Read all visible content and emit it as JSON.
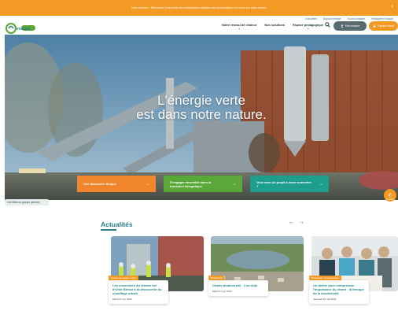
{
  "topbar": {
    "message": "Infos réseaux : Retrouvez l'ensemble des informations relatives aux perturbations en cours sur votre réseau",
    "close": "×"
  },
  "util_links": [
    "Actualités",
    "Espace presse",
    "Nous contacter",
    "Rejoignez l'équipe"
  ],
  "logo": {
    "text": "energie",
    "sub": "du réseau"
  },
  "nav": {
    "items": [
      {
        "label": "Notre réseau de chaleur",
        "dropdown": true
      },
      {
        "label": "Nos solutions",
        "dropdown": false
      },
      {
        "label": "Espace pédagogique",
        "dropdown": true
      }
    ],
    "chevron": "⌄"
  },
  "actions": {
    "search_icon": "🔍",
    "login_label": "Mon espace",
    "client_label": "Espace client"
  },
  "hero": {
    "title_line1": "L'énergie verte",
    "title_line2": "est dans notre nature."
  },
  "ctas": [
    {
      "label": "Une démarche éthique",
      "color": "#f0852b"
    },
    {
      "label": "S'engager ensemble dans la transition énergétique",
      "color": "#5aa938"
    },
    {
      "label": "Vous avez un projet à nous soumettre ?",
      "color": "#1e9e8c"
    }
  ],
  "arrow": "→",
  "group_select": "Voir filiale du groupe (interne)",
  "contact": {
    "icon": "✆",
    "label": "Contact"
  },
  "news": {
    "title": "Actualités",
    "prev": "←",
    "next": "→",
    "cards": [
      {
        "tag": "Réseau de chaleur urbain",
        "title": "Les conseillers du réseau Val d'Orbe Bémar à la découverte du chauffage urbain",
        "date": "Mardi 27 juin 2023"
      },
      {
        "tag": "Biodiversité",
        "title": "Charte biodiversité : 1 an déjà",
        "date": "Mardi 27 juin 2023"
      },
      {
        "tag": "Biodiversité, communication",
        "title": "Un atelier pour comprendre l'importance du vivant : la fresque de la biodiversité",
        "date": "Vendredi 26 mai 2023"
      }
    ]
  },
  "colors": {
    "orange": "#f39a24",
    "teal": "#2e7c86",
    "green": "#5aa938",
    "dark": "#14343a"
  }
}
